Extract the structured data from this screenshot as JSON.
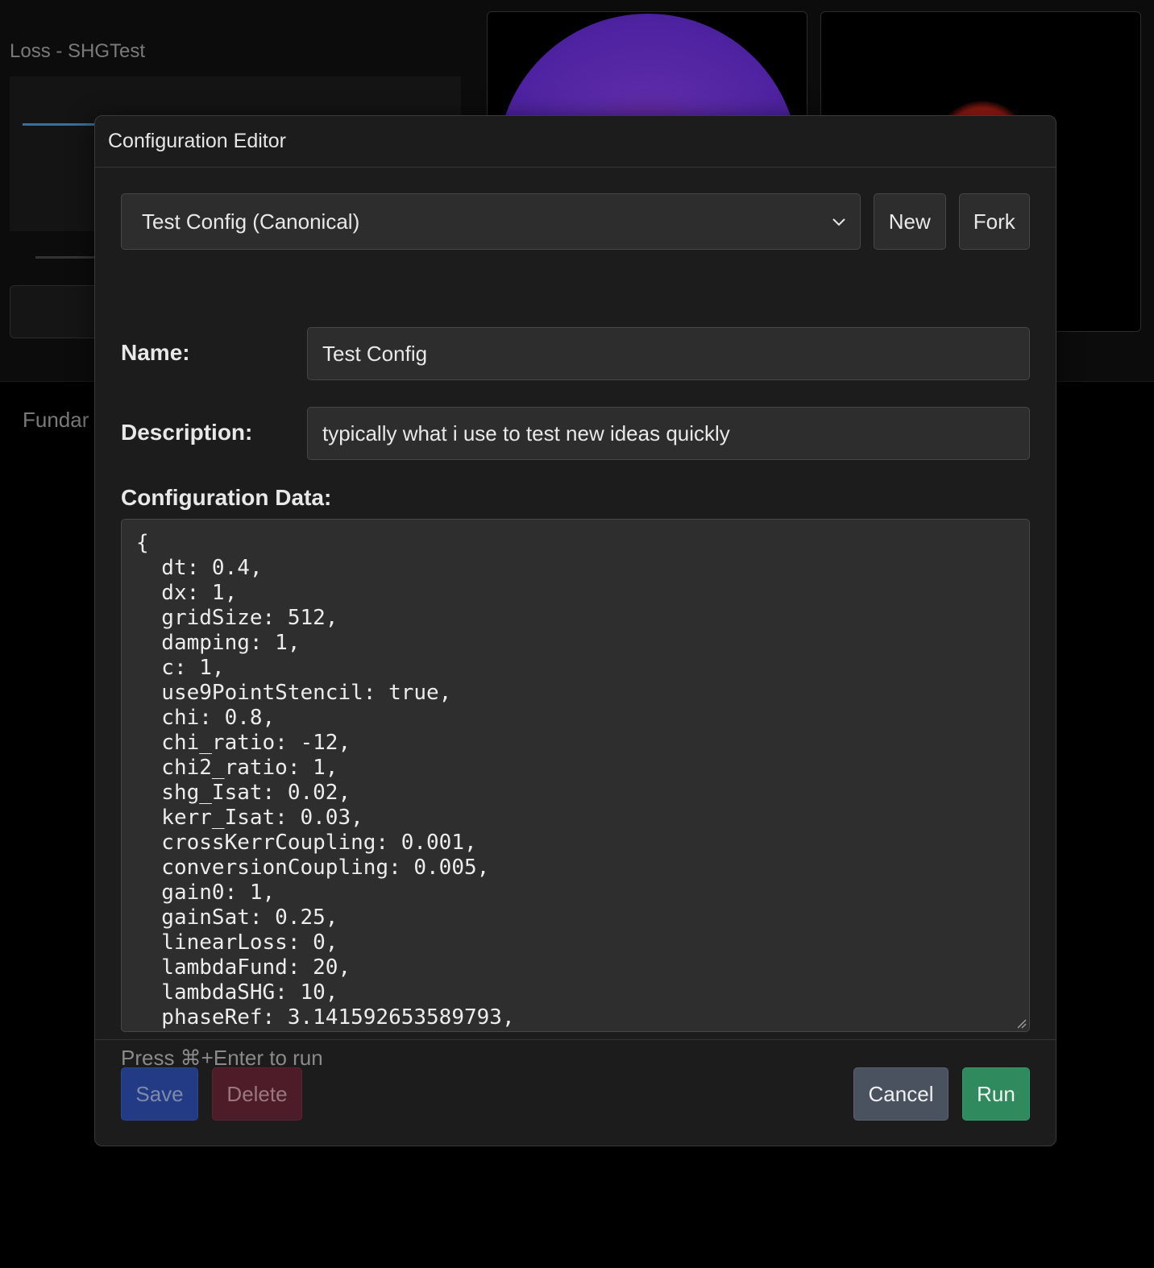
{
  "background": {
    "loss_title": "Loss - SHGTest",
    "fund_label": "Fundar"
  },
  "modal": {
    "title": "Configuration Editor",
    "config_select": {
      "selected": "Test Config (Canonical)"
    },
    "new_label": "New",
    "fork_label": "Fork",
    "name_label": "Name:",
    "name_value": "Test Config",
    "description_label": "Description:",
    "description_value": "typically what i use to test new ideas quickly",
    "config_data_label": "Configuration Data:",
    "config_lines": [
      "{",
      "  dt: 0.4,",
      "  dx: 1,",
      "  gridSize: 512,",
      "  damping: 1,",
      "  c: 1,",
      "  use9PointStencil: true,",
      "  chi: 0.8,",
      "  chi_ratio: -12,",
      "  chi2_ratio: 1,",
      "  shg_Isat: 0.02,",
      "  kerr_Isat: 0.03,",
      "  crossKerrCoupling: 0.001,",
      "  conversionCoupling: 0.005,",
      "  gain0: 1,",
      "  gainSat: 0.25,",
      "  linearLoss: 0,",
      "  lambdaFund: 20,",
      "  lambdaSHG: 10,",
      "  phaseRef: 3.141592653589793,"
    ],
    "hint": "Press ⌘+Enter to run",
    "footer": {
      "save_label": "Save",
      "delete_label": "Delete",
      "cancel_label": "Cancel",
      "run_label": "Run"
    }
  },
  "colors": {
    "modal_bg": "#1c1c1c",
    "input_bg": "#2d2d2d",
    "save": "#233a84",
    "delete": "#4e1c28",
    "cancel": "#4a5260",
    "run": "#2f8a5e"
  }
}
